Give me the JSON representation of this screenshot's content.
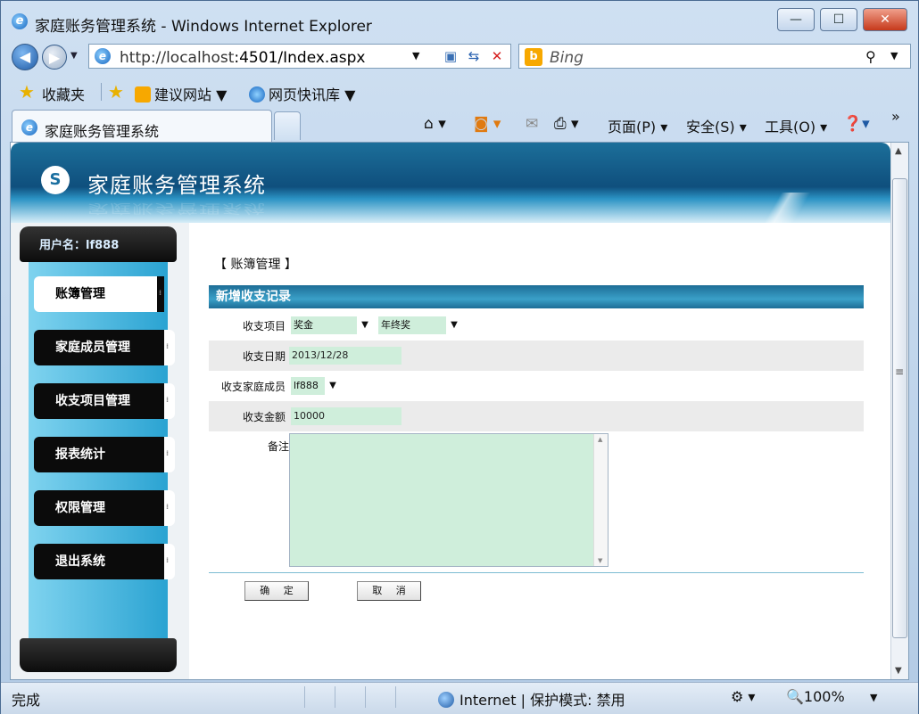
{
  "window": {
    "title": "家庭账务管理系统 - Windows Internet Explorer",
    "minimize": "—",
    "maximize": "☐",
    "close": "✕"
  },
  "addressbar": {
    "url_host": "http://localhost",
    "url_rest": ":4501/Index.aspx",
    "search_placeholder": "Bing"
  },
  "favorites": {
    "label": "收藏夹",
    "items": [
      {
        "label": "建议网站 ▼"
      },
      {
        "label": "网页快讯库 ▼"
      }
    ]
  },
  "tab": {
    "label": "家庭账务管理系统"
  },
  "commandbar": {
    "page": "页面(P) ▾",
    "safety": "安全(S) ▾",
    "tools": "工具(O) ▾",
    "more": "»"
  },
  "site": {
    "title": "家庭账务管理系统"
  },
  "sidebar": {
    "user": "用户名：lf888",
    "items": [
      {
        "label": "账簿管理",
        "active": true
      },
      {
        "label": "家庭成员管理",
        "active": false
      },
      {
        "label": "收支项目管理",
        "active": false
      },
      {
        "label": "报表统计",
        "active": false
      },
      {
        "label": "权限管理",
        "active": false
      },
      {
        "label": "退出系统",
        "active": false
      }
    ]
  },
  "main": {
    "breadcrumb": "【 账簿管理 】",
    "section_title": "新增收支记录",
    "fields": {
      "item_label": "收支项目",
      "item_category": "奖金",
      "item_sub": "年终奖",
      "date_label": "收支日期",
      "date_value": "2013/12/28",
      "member_label": "收支家庭成员",
      "member_value": "lf888",
      "amount_label": "收支金额",
      "amount_value": "10000",
      "note_label": "备注"
    },
    "buttons": {
      "ok": "确 定",
      "cancel": "取 消"
    }
  },
  "statusbar": {
    "left": "完成",
    "zone": "Internet | 保护模式: 禁用",
    "zoom": "100%"
  }
}
